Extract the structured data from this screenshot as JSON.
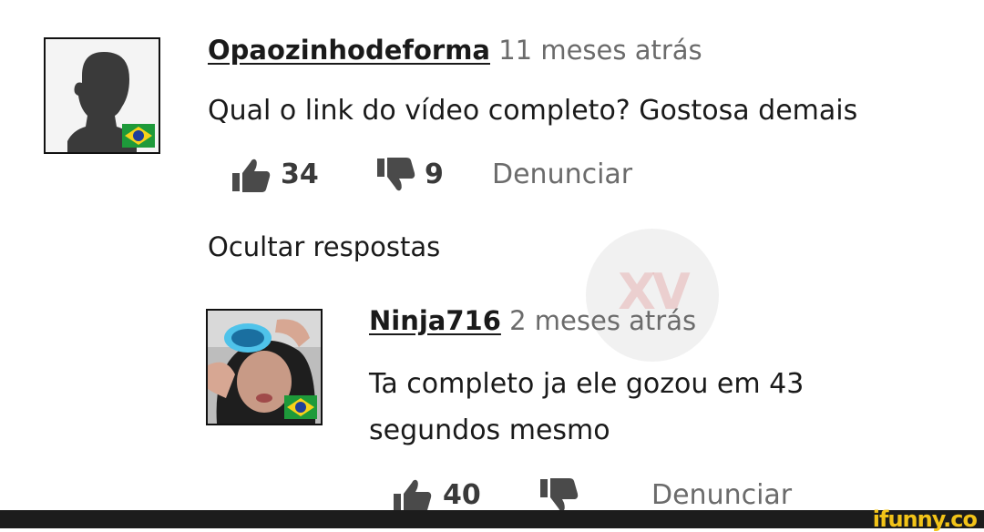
{
  "comment": {
    "username": "Opaozinhodeforma",
    "time": "11 meses atrás",
    "text": "Qual o link do vídeo completo? Gostosa demais",
    "likes": "34",
    "dislikes": "9",
    "report_label": "Denunciar"
  },
  "hide_replies_label": "Ocultar respostas",
  "reply": {
    "username": "Ninja716",
    "time": "2 meses atrás",
    "text": "Ta completo ja ele gozou em 43 segundos mesmo",
    "likes": "40",
    "report_label": "Denunciar"
  },
  "watermark": {
    "text": "XV"
  },
  "footer": {
    "brand": "ifunny.co"
  },
  "colors": {
    "flag_green": "#1e9a3a",
    "flag_yellow": "#f7d21a",
    "flag_blue": "#1f3f9a",
    "brand_yellow": "#f2c318"
  }
}
